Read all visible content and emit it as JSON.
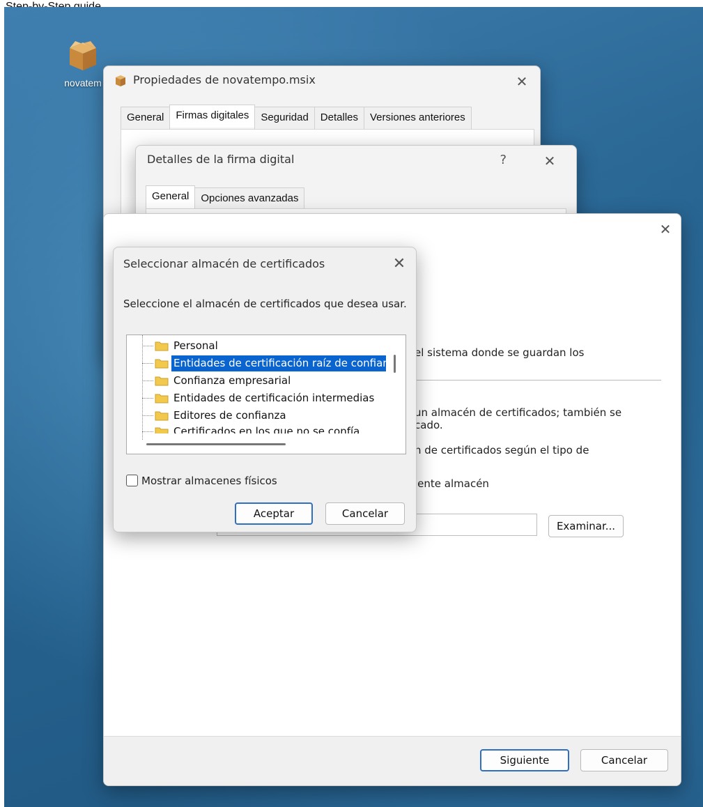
{
  "caption": "Step-by-Step guide",
  "desktop": {
    "icon_label": "novatem"
  },
  "props_window": {
    "title": "Propiedades de novatempo.msix",
    "tabs": [
      "General",
      "Firmas digitales",
      "Seguridad",
      "Detalles",
      "Versiones anteriores"
    ],
    "active_tab": 1
  },
  "sig_details_window": {
    "title": "Detalles de la firma digital",
    "help": "?",
    "tabs": [
      "General",
      "Opciones avanzadas"
    ]
  },
  "wizard": {
    "line1": "el sistema donde se guardan los",
    "line2": "un almacén de certificados; también se",
    "line3": "cado.",
    "line4": "n de certificados según el tipo de",
    "line5": "iente almacén",
    "browse_button": "Examinar...",
    "next_button": "Siguiente",
    "cancel_button": "Cancelar"
  },
  "store_dialog": {
    "title": "Seleccionar almacén de certificados",
    "instruction": "Seleccione el almacén de certificados que desea usar.",
    "items": [
      "Personal",
      "Entidades de certificación raíz de confianza",
      "Confianza empresarial",
      "Entidades de certificación intermedias",
      "Editores de confianza",
      "Certificados en los que no se confía"
    ],
    "selected_index": 1,
    "show_physical_label": "Mostrar almacenes físicos",
    "show_physical_checked": false,
    "ok_button": "Aceptar",
    "cancel_button": "Cancelar"
  },
  "colors": {
    "selection": "#0a64d0",
    "primary_border": "#2f6ec0",
    "folder": "#f2c94c"
  },
  "icons": {
    "desktop": "package-box-icon",
    "close": "close-icon",
    "folder": "folder-icon"
  }
}
